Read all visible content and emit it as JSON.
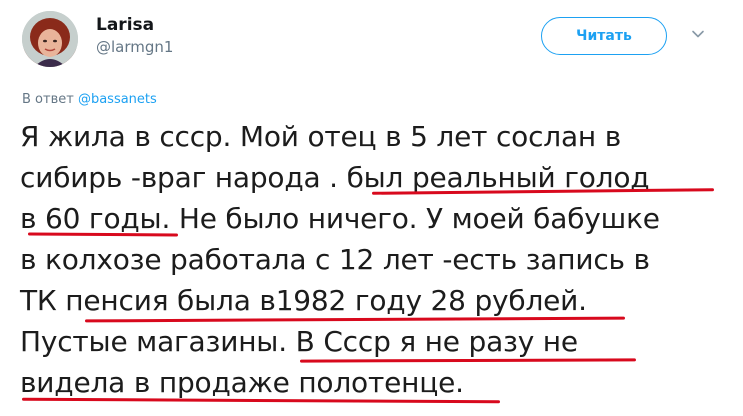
{
  "user": {
    "name": "Larisa",
    "handle": "@larmgn1"
  },
  "follow_button": {
    "label": "Читать"
  },
  "reply": {
    "prefix": "В ответ",
    "mention": "@bassanets"
  },
  "tweet": {
    "lines": [
      "Я жила в ссср. Мой отец в 5 лет сослан в",
      "сибирь -враг народа . был реальный голод",
      "в 60 годы. Не было ничего. У моей бабушке",
      "в колхозе работала с 12 лет -есть запись в",
      "ТК пенсия была в1982 году 28 рублей.",
      "Пустые магазины. В Ссср я не разу не",
      "видела в продаже полотенце."
    ]
  },
  "colors": {
    "accent": "#1da1f2",
    "underline": "#d8091d",
    "secondary_text": "#657786"
  }
}
